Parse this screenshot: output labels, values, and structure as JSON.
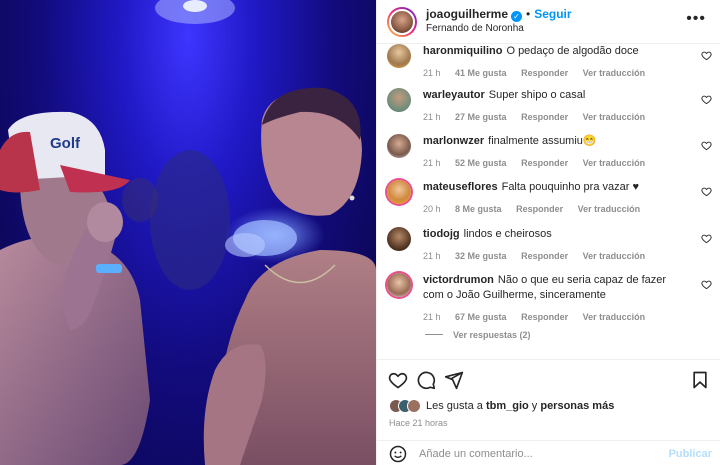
{
  "post": {
    "username": "joaoguilherme",
    "location": "Fernando de Noronha",
    "follow_label": "Seguir",
    "verified_icon": "verified-badge-icon"
  },
  "comments": [
    {
      "user": "haronmiquilino",
      "text": "O pedaço de algodão doce",
      "time": "21 h",
      "likes": "41 Me gusta",
      "reply": "Responder",
      "translate": "Ver traducción"
    },
    {
      "user": "warleyautor",
      "text": "Super shipo o casal",
      "time": "21 h",
      "likes": "27 Me gusta",
      "reply": "Responder",
      "translate": "Ver traducción"
    },
    {
      "user": "marlonwzer",
      "text": "finalmente assumiu😁",
      "time": "21 h",
      "likes": "52 Me gusta",
      "reply": "Responder",
      "translate": "Ver traducción"
    },
    {
      "user": "mateuseflores",
      "text": "Falta pouquinho pra vazar ♥",
      "time": "20 h",
      "likes": "8 Me gusta",
      "reply": "Responder",
      "translate": "Ver traducción"
    },
    {
      "user": "tiodojg",
      "text": "lindos e cheirosos",
      "time": "21 h",
      "likes": "32 Me gusta",
      "reply": "Responder",
      "translate": "Ver traducción"
    },
    {
      "user": "victordrumon",
      "text": "Não o que eu seria capaz de fazer com o João Guilherme, sinceramente",
      "time": "21 h",
      "likes": "67 Me gusta",
      "reply": "Responder",
      "translate": "Ver traducción"
    }
  ],
  "replies_label": "Ver respuestas (2)",
  "likes_summary": {
    "prefix": "Les gusta a",
    "user": "tbm_gio",
    "joiner": "y",
    "others": "personas más"
  },
  "time_ago": "Hace 21 horas",
  "comment_input": {
    "placeholder": "Añade un comentario...",
    "value": ""
  },
  "publish_label": "Publicar",
  "photo": {
    "cap_text": "Golf"
  },
  "colors": {
    "accent": "#0095f6",
    "publish_disabled": "#b2dffc",
    "muted": "#8e8e8e"
  }
}
